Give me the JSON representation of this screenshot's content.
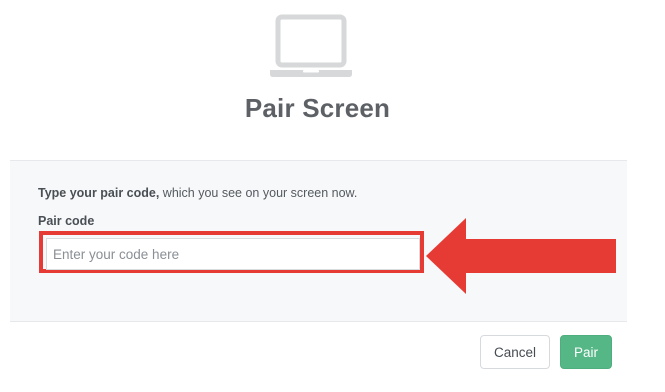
{
  "header": {
    "icon": "laptop-icon",
    "title": "Pair Screen"
  },
  "form": {
    "instruction_bold": "Type your pair code,",
    "instruction_rest": " which you see on your screen now.",
    "field_label": "Pair code",
    "input_value": "",
    "input_placeholder": "Enter your code here"
  },
  "annotation": {
    "highlight_color": "#e63b34",
    "arrow_icon": "arrow-left-icon"
  },
  "actions": {
    "cancel_label": "Cancel",
    "pair_label": "Pair",
    "pair_color": "#55b786"
  }
}
